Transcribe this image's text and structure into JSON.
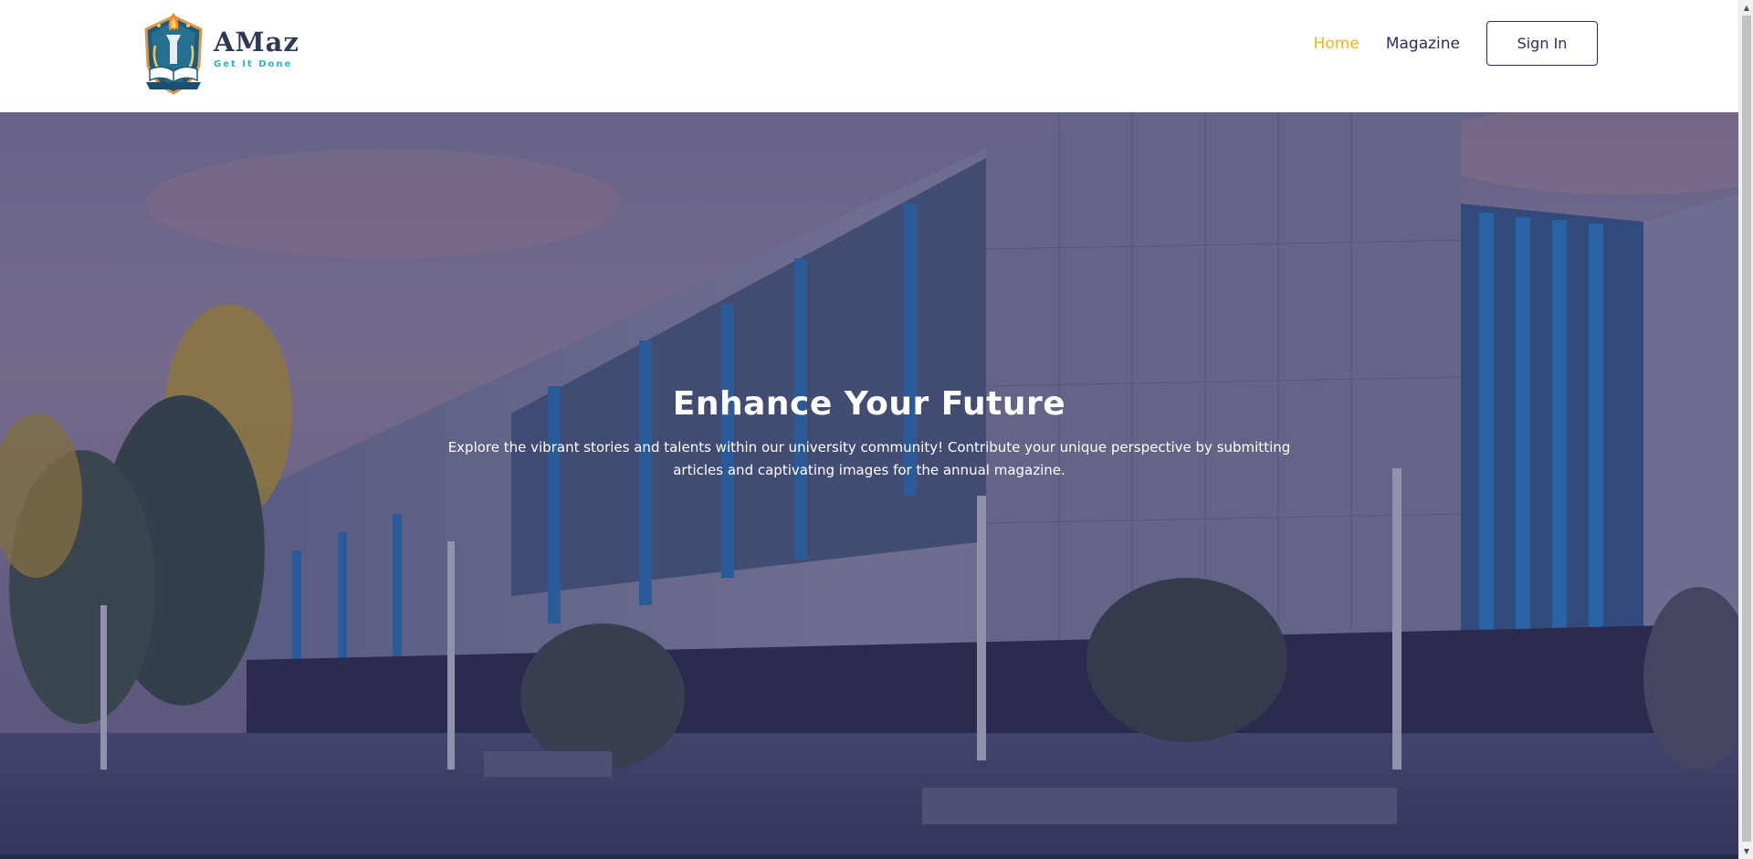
{
  "brand": {
    "name": "AMaz",
    "tagline": "Get It Done",
    "emblem_icon": "torch-book-shield-logo",
    "colors": {
      "name": "#2e3a52",
      "tagline": "#29b6c5"
    }
  },
  "nav": {
    "items": [
      {
        "label": "Home",
        "active": true
      },
      {
        "label": "Magazine",
        "active": false
      }
    ],
    "signin_label": "Sign In",
    "colors": {
      "active": "#f4b41a",
      "default": "#2b2d5c"
    }
  },
  "hero": {
    "title": "Enhance Your Future",
    "subtitle": "Explore the vibrant stories and talents within our university community! Contribute your unique perspective by submitting articles and captivating images for the annual magazine.",
    "background": "university-building-photo",
    "overlay_color": "#262454"
  },
  "scrollbar": {
    "up_icon": "scroll-up-arrow-icon",
    "down_icon": "scroll-down-arrow-icon"
  }
}
